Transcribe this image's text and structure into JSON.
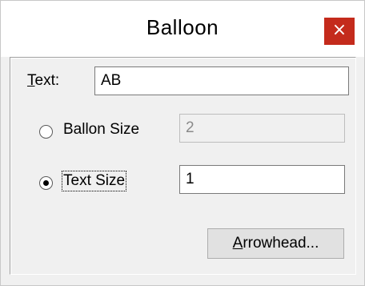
{
  "window": {
    "title": "Balloon",
    "close_glyph": "×"
  },
  "form": {
    "text_label_mnemonic": "T",
    "text_label_rest": "ext:",
    "text_value": "AB",
    "balloon_size_label": "Ballon Size",
    "balloon_size_value": "2",
    "balloon_size_selected": false,
    "text_size_label": "Text Size",
    "text_size_value": "1",
    "text_size_selected": true
  },
  "buttons": {
    "arrowhead_mnemonic": "A",
    "arrowhead_rest": "rrowhead..."
  },
  "icons": {
    "close": "close-icon"
  },
  "colors": {
    "close_bg": "#c42b1c",
    "dialog_bg": "#f0f0f0"
  }
}
